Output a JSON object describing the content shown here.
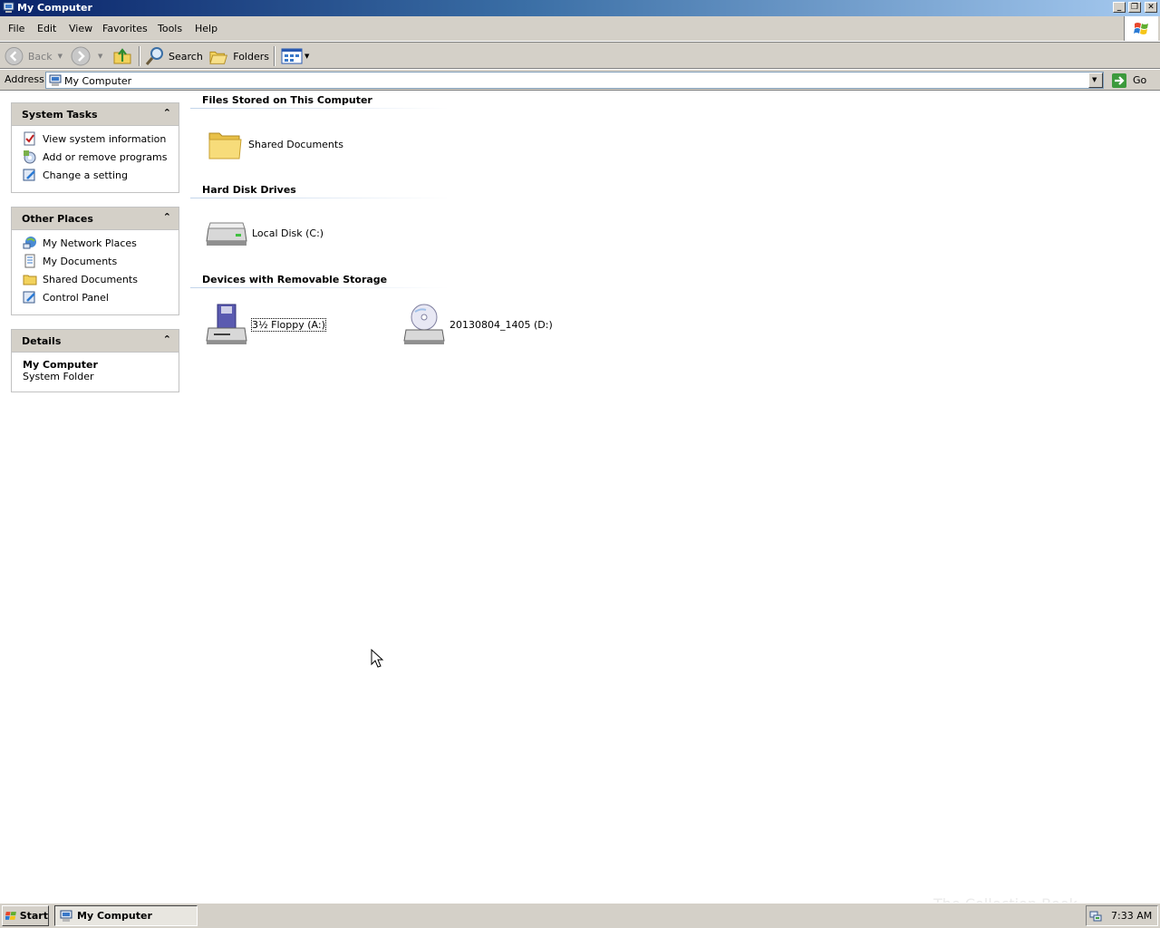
{
  "window": {
    "title": "My Computer",
    "min_label": "_",
    "max_label": "❐",
    "close_label": "✕"
  },
  "menu": [
    "File",
    "Edit",
    "View",
    "Favorites",
    "Tools",
    "Help"
  ],
  "toolbar": {
    "back_label": "Back",
    "search_label": "Search",
    "folders_label": "Folders"
  },
  "address": {
    "label": "Address",
    "value": "My Computer",
    "go_label": "Go"
  },
  "panels": {
    "system_tasks": {
      "title": "System Tasks",
      "items": [
        "View system information",
        "Add or remove programs",
        "Change a setting"
      ]
    },
    "other_places": {
      "title": "Other Places",
      "items": [
        "My Network Places",
        "My Documents",
        "Shared Documents",
        "Control Panel"
      ]
    },
    "details": {
      "title": "Details",
      "name": "My Computer",
      "type": "System Folder"
    }
  },
  "sections": {
    "files": {
      "title": "Files Stored on This Computer",
      "items": [
        "Shared Documents"
      ]
    },
    "hdd": {
      "title": "Hard Disk Drives",
      "items": [
        "Local Disk (C:)"
      ]
    },
    "removable": {
      "title": "Devices with Removable Storage",
      "items": [
        "3½ Floppy (A:)",
        "20130804_1405 (D:)"
      ]
    }
  },
  "taskbar": {
    "start_label": "Start",
    "task_label": "My Computer",
    "clock": "7:33 AM"
  },
  "watermark": "The Collection Book",
  "colors": {
    "titlebar_start": "#0a246a",
    "titlebar_end": "#a6caf0",
    "face": "#d4d0c8"
  }
}
